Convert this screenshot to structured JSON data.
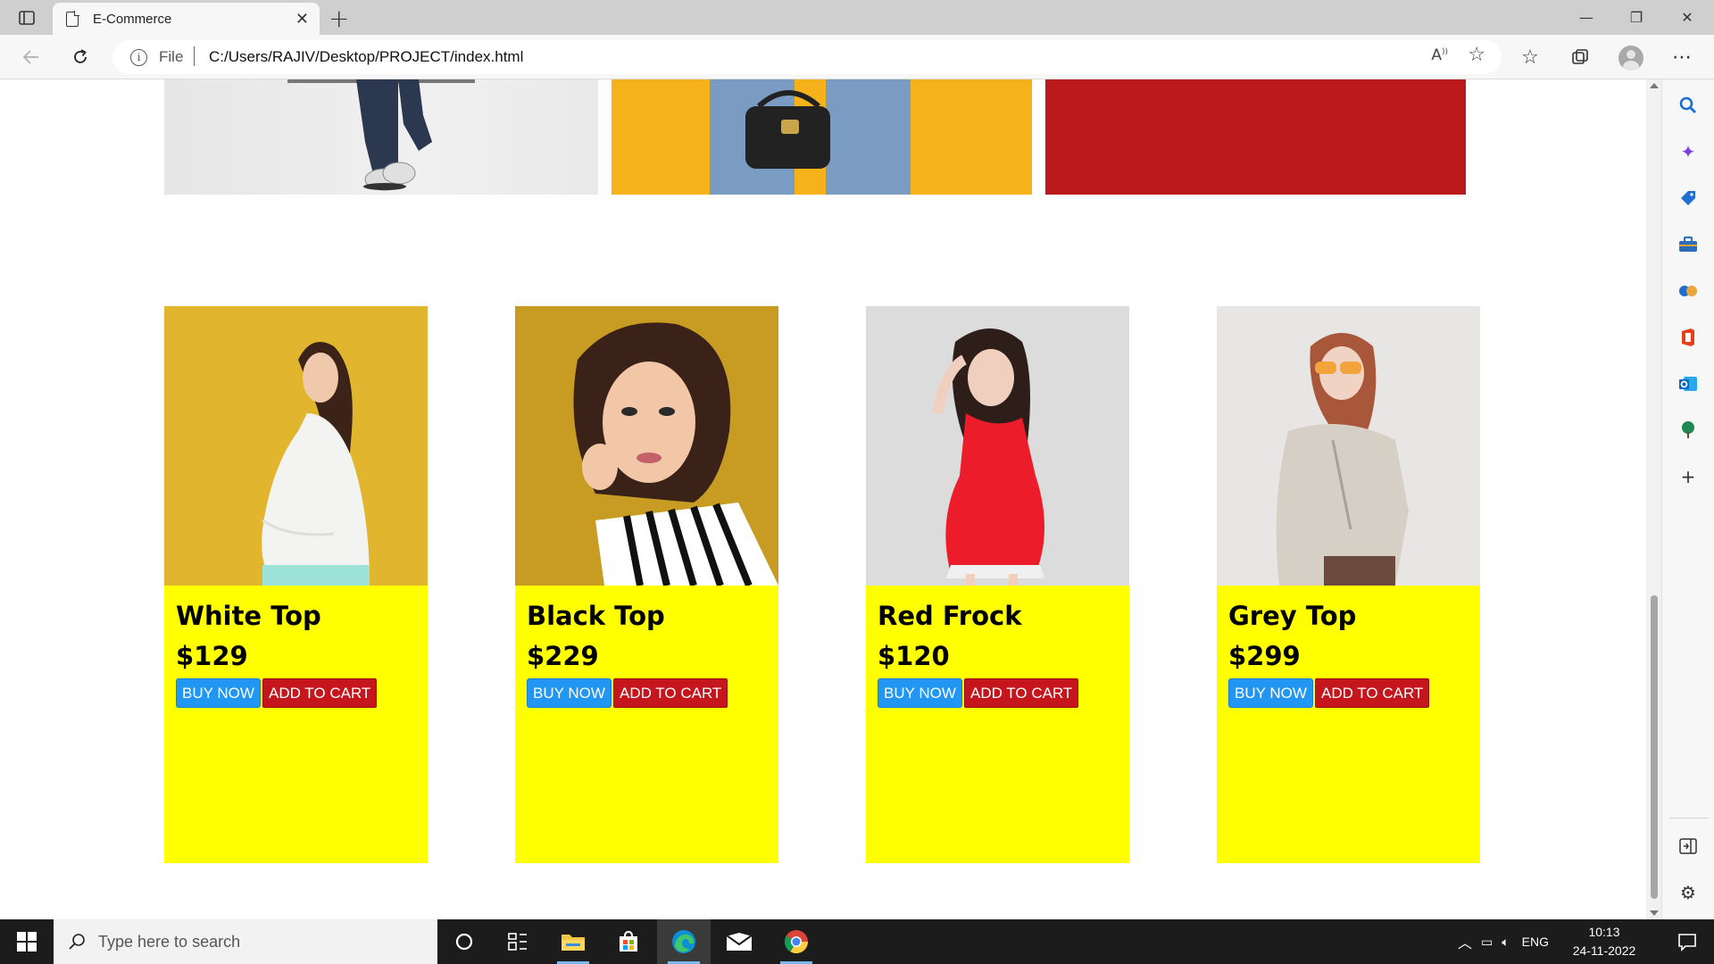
{
  "browser": {
    "tab_title": "E-Commerce",
    "address_scheme": "File",
    "address_url": "C:/Users/RAJIV/Desktop/PROJECT/index.html"
  },
  "products": [
    {
      "name": "White Top",
      "price": "$129",
      "buy_label": "BUY NOW",
      "cart_label": "ADD TO CART"
    },
    {
      "name": "Black Top",
      "price": "$229",
      "buy_label": "BUY NOW",
      "cart_label": "ADD TO CART"
    },
    {
      "name": "Red Frock",
      "price": "$120",
      "buy_label": "BUY NOW",
      "cart_label": "ADD TO CART"
    },
    {
      "name": "Grey Top",
      "price": "$299",
      "buy_label": "BUY NOW",
      "cart_label": "ADD TO CART"
    }
  ],
  "colors": {
    "card_bg": "#ffff00",
    "buy_button": "#2196f3",
    "cart_button": "#c4161c",
    "banner_yellow": "#f5b21b",
    "banner_red": "#bb1a1c"
  },
  "taskbar": {
    "search_placeholder": "Type here to search",
    "language": "ENG",
    "time": "10:13",
    "date": "24-11-2022"
  }
}
